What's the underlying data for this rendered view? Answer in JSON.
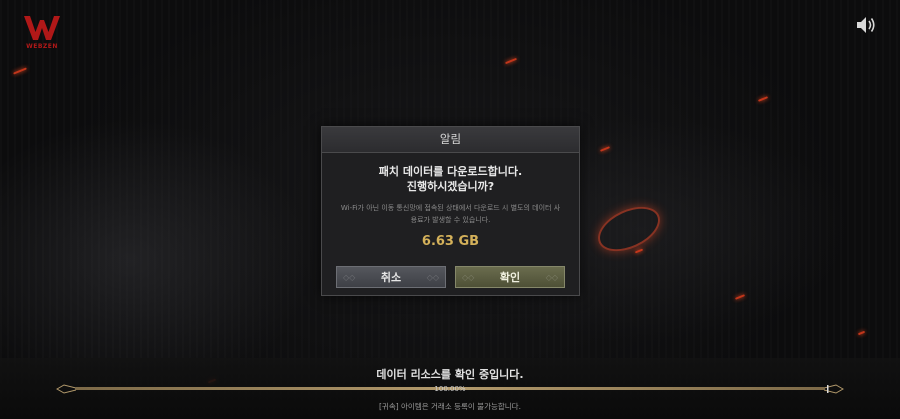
{
  "brand": {
    "logo_text": "WEBZEN"
  },
  "icons": {
    "logo": "webzen-w-logo-icon",
    "sound": "speaker-icon"
  },
  "dialog": {
    "title": "알림",
    "message_line1": "패치 데이터를 다운로드합니다.",
    "message_line2": "진행하시겠습니까?",
    "notice": "Wi-Fi가 아닌 이동 통신망에 접속된 상태에서 다운로드 시 별도의 데이터 사용료가 발생할 수 있습니다.",
    "download_size": "6.63 GB",
    "cancel_label": "취소",
    "confirm_label": "확인"
  },
  "footer": {
    "status_text": "데이터 리소스를 확인 중입니다.",
    "progress_label": "100.00%",
    "progress_fraction": 1.0,
    "tip_text": "[귀속] 아이템은 거래소 등록이 불가능합니다."
  },
  "colors": {
    "brand_red": "#b01818",
    "size_gold": "#d4b15a",
    "ember": "#c2361b"
  }
}
